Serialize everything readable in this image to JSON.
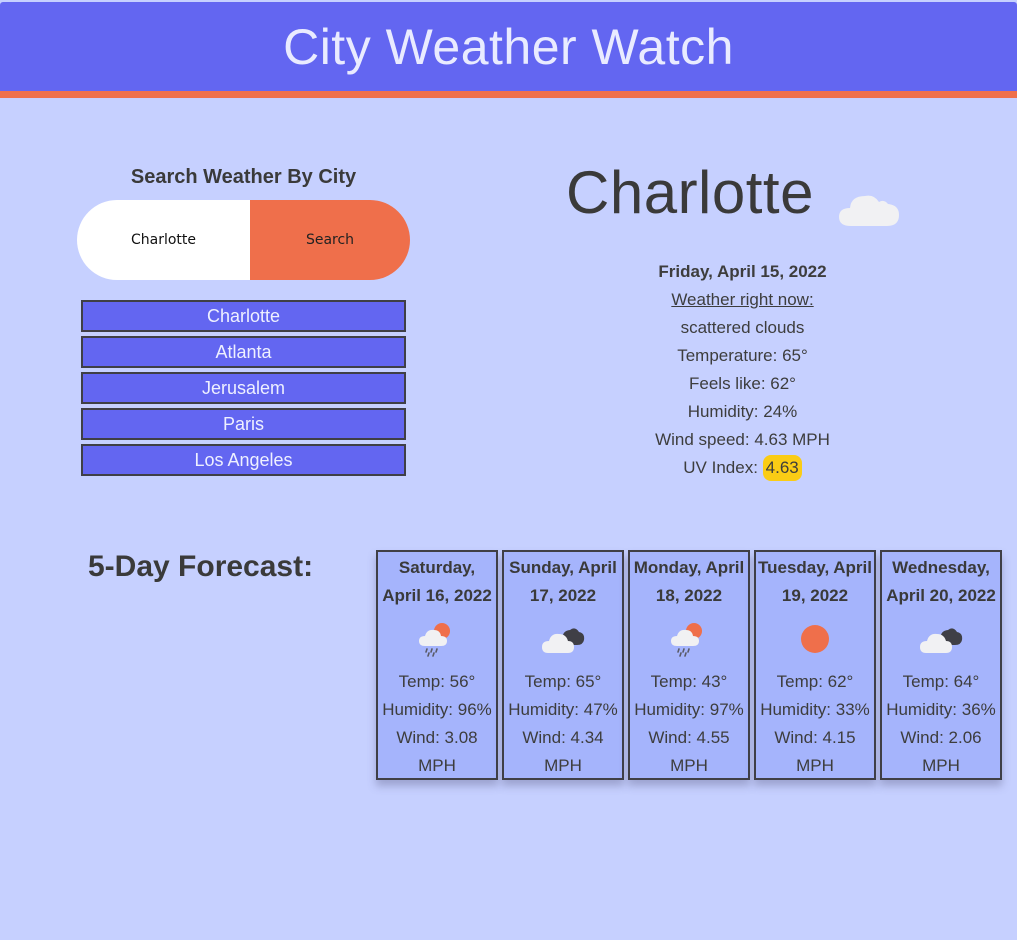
{
  "header": {
    "title": "City Weather Watch"
  },
  "search": {
    "title": "Search Weather By City",
    "value": "Charlotte",
    "button_label": "Search"
  },
  "history": [
    "Charlotte",
    "Atlanta",
    "Jerusalem",
    "Paris",
    "Los Angeles"
  ],
  "current": {
    "city": "Charlotte",
    "icon": "cloud-icon",
    "date": "Friday, April 15, 2022",
    "now_label": "Weather right now:",
    "description": "scattered clouds",
    "temperature": "Temperature: 65°",
    "feels_like": "Feels like: 62°",
    "humidity": "Humidity: 24%",
    "wind": "Wind speed: 4.63 MPH",
    "uv_label": "UV Index: ",
    "uv_value": "4.63"
  },
  "forecast": {
    "title": "5-Day Forecast:",
    "days": [
      {
        "date": "Saturday, April 16, 2022",
        "icon": "rain-sun-icon",
        "temp": "Temp: 56°",
        "humidity": "Humidity: 96%",
        "wind": "Wind: 3.08 MPH"
      },
      {
        "date": "Sunday, April 17, 2022",
        "icon": "dark-clouds-icon",
        "temp": "Temp: 65°",
        "humidity": "Humidity: 47%",
        "wind": "Wind: 4.34 MPH"
      },
      {
        "date": "Monday, April 18, 2022",
        "icon": "rain-sun-icon",
        "temp": "Temp: 43°",
        "humidity": "Humidity: 97%",
        "wind": "Wind: 4.55 MPH"
      },
      {
        "date": "Tuesday, April 19, 2022",
        "icon": "sun-icon",
        "temp": "Temp: 62°",
        "humidity": "Humidity: 33%",
        "wind": "Wind: 4.15 MPH"
      },
      {
        "date": "Wednesday, April 20, 2022",
        "icon": "dark-clouds-icon",
        "temp": "Temp: 64°",
        "humidity": "Humidity: 36%",
        "wind": "Wind: 2.06 MPH"
      }
    ]
  },
  "colors": {
    "background": "#c6d0ff",
    "header": "#6366f1",
    "accent": "#ef6f4b",
    "card": "#a5b4fc",
    "uv_badge": "#facc15"
  }
}
